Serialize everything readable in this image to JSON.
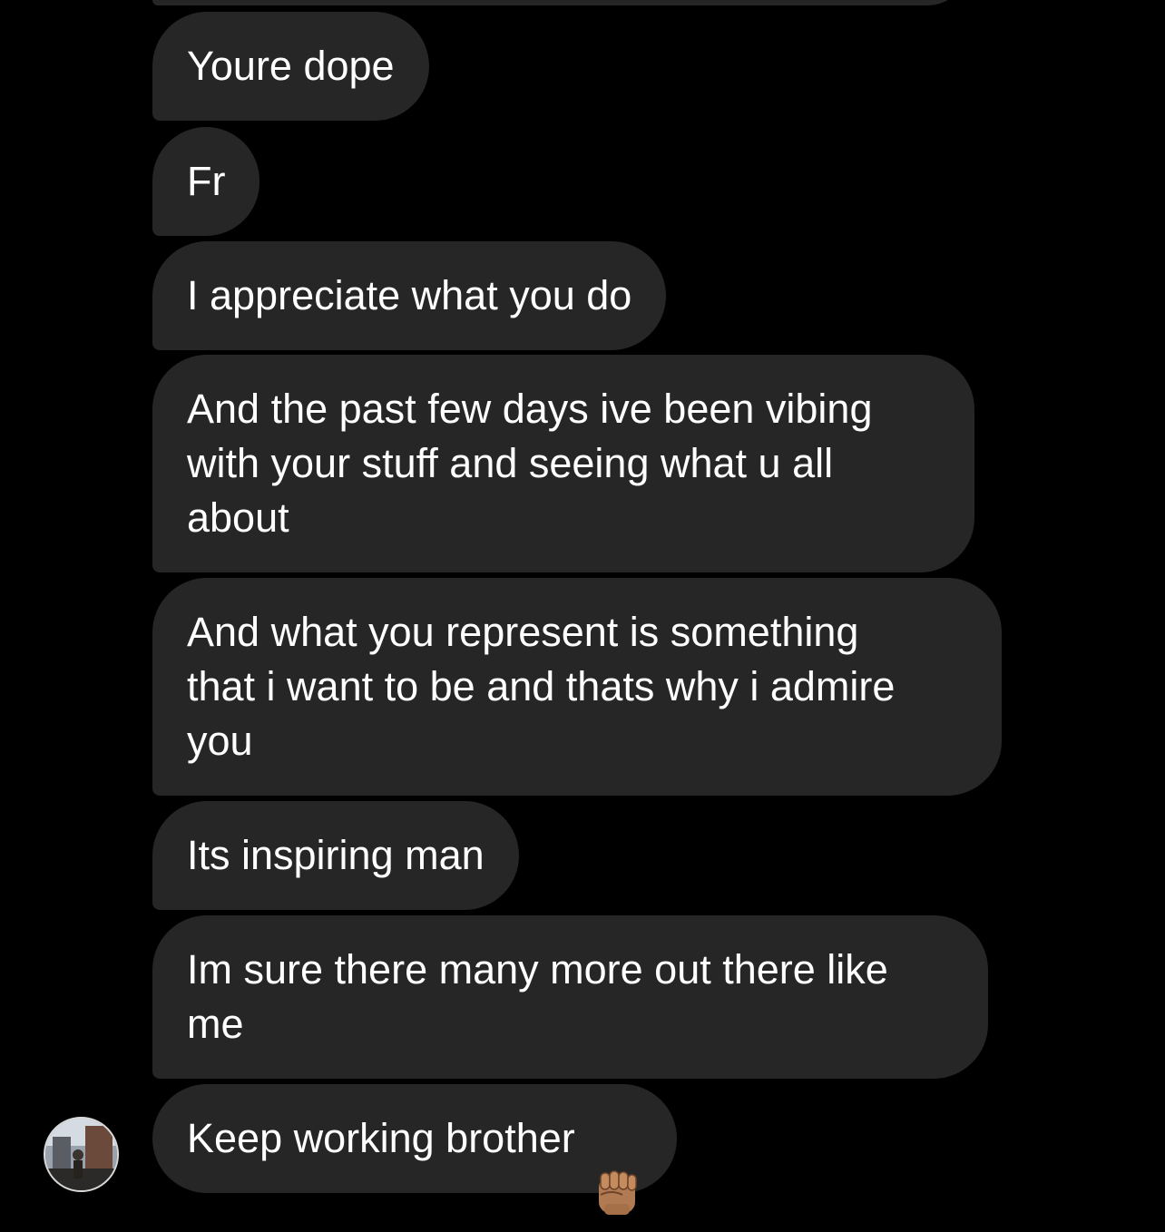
{
  "conversation": {
    "messages": [
      {
        "text": "Youre dope"
      },
      {
        "text": "Fr"
      },
      {
        "text": "I appreciate what you do"
      },
      {
        "text": "And the past few days ive been vibing\nwith your stuff and seeing what u all\nabout"
      },
      {
        "text": "And what you represent is something\nthat i want to be and thats why i admire\nyou"
      },
      {
        "text": "Its inspiring man"
      },
      {
        "text": "Im sure there many more out there like\nme"
      },
      {
        "text": "Keep working brother",
        "emoji": "raised-fist-medium-skin-tone-icon"
      }
    ]
  },
  "colors": {
    "background": "#000000",
    "bubble": "#262626",
    "text": "#ffffff"
  },
  "icons": {
    "sender_avatar": "avatar"
  }
}
